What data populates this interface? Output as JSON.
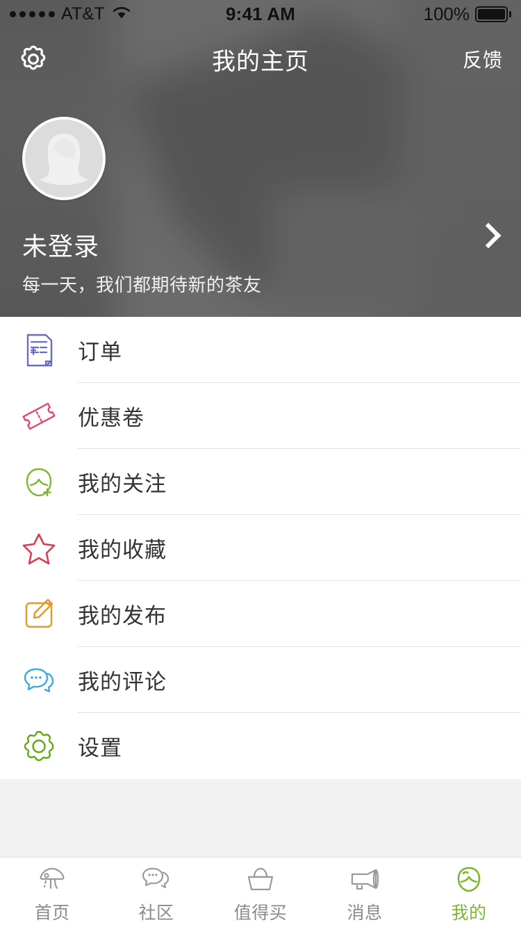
{
  "status_bar": {
    "carrier": "AT&T",
    "signal_dots": 5,
    "wifi_icon": "wifi-icon",
    "time": "9:41 AM",
    "battery_percent": "100%",
    "battery_icon": "battery-full-icon"
  },
  "navbar": {
    "left_icon": "gear-icon",
    "title": "我的主页",
    "right_action": "反馈"
  },
  "profile": {
    "avatar_icon": "default-female-avatar-icon",
    "name": "未登录",
    "subtitle": "每一天，我们都期待新的茶友",
    "chevron_icon": "chevron-right-icon"
  },
  "menu": {
    "items": [
      {
        "label": "订单",
        "icon": "order-invoice-icon",
        "color": "#6a6 acb"
      },
      {
        "label": "优惠卷",
        "icon": "coupon-ticket-icon",
        "color": "#e0457b"
      },
      {
        "label": "我的关注",
        "icon": "follow-person-add-icon",
        "color": "#7cb82f"
      },
      {
        "label": "我的收藏",
        "icon": "star-icon",
        "color": "#e0384f"
      },
      {
        "label": "我的发布",
        "icon": "edit-pencil-icon",
        "color": "#e8972a"
      },
      {
        "label": "我的评论",
        "icon": "comment-bubbles-icon",
        "color": "#3ba9e0"
      },
      {
        "label": "设置",
        "icon": "settings-gear-icon",
        "color": "#62a712"
      }
    ]
  },
  "tabbar": {
    "items": [
      {
        "label": "首页",
        "icon": "mushroom-home-icon",
        "active": false
      },
      {
        "label": "社区",
        "icon": "community-bubbles-icon",
        "active": false
      },
      {
        "label": "值得买",
        "icon": "shopping-basket-icon",
        "active": false
      },
      {
        "label": "消息",
        "icon": "megaphone-icon",
        "active": false
      },
      {
        "label": "我的",
        "icon": "profile-head-icon",
        "active": true
      }
    ]
  },
  "colors": {
    "active_green": "#7cb82f",
    "inactive_gray": "#8a8a8a",
    "label_dark": "#333333",
    "divider": "#e3e3e3",
    "filler_gray": "#f2f2f2",
    "header_gray": "#6b6b6b"
  }
}
